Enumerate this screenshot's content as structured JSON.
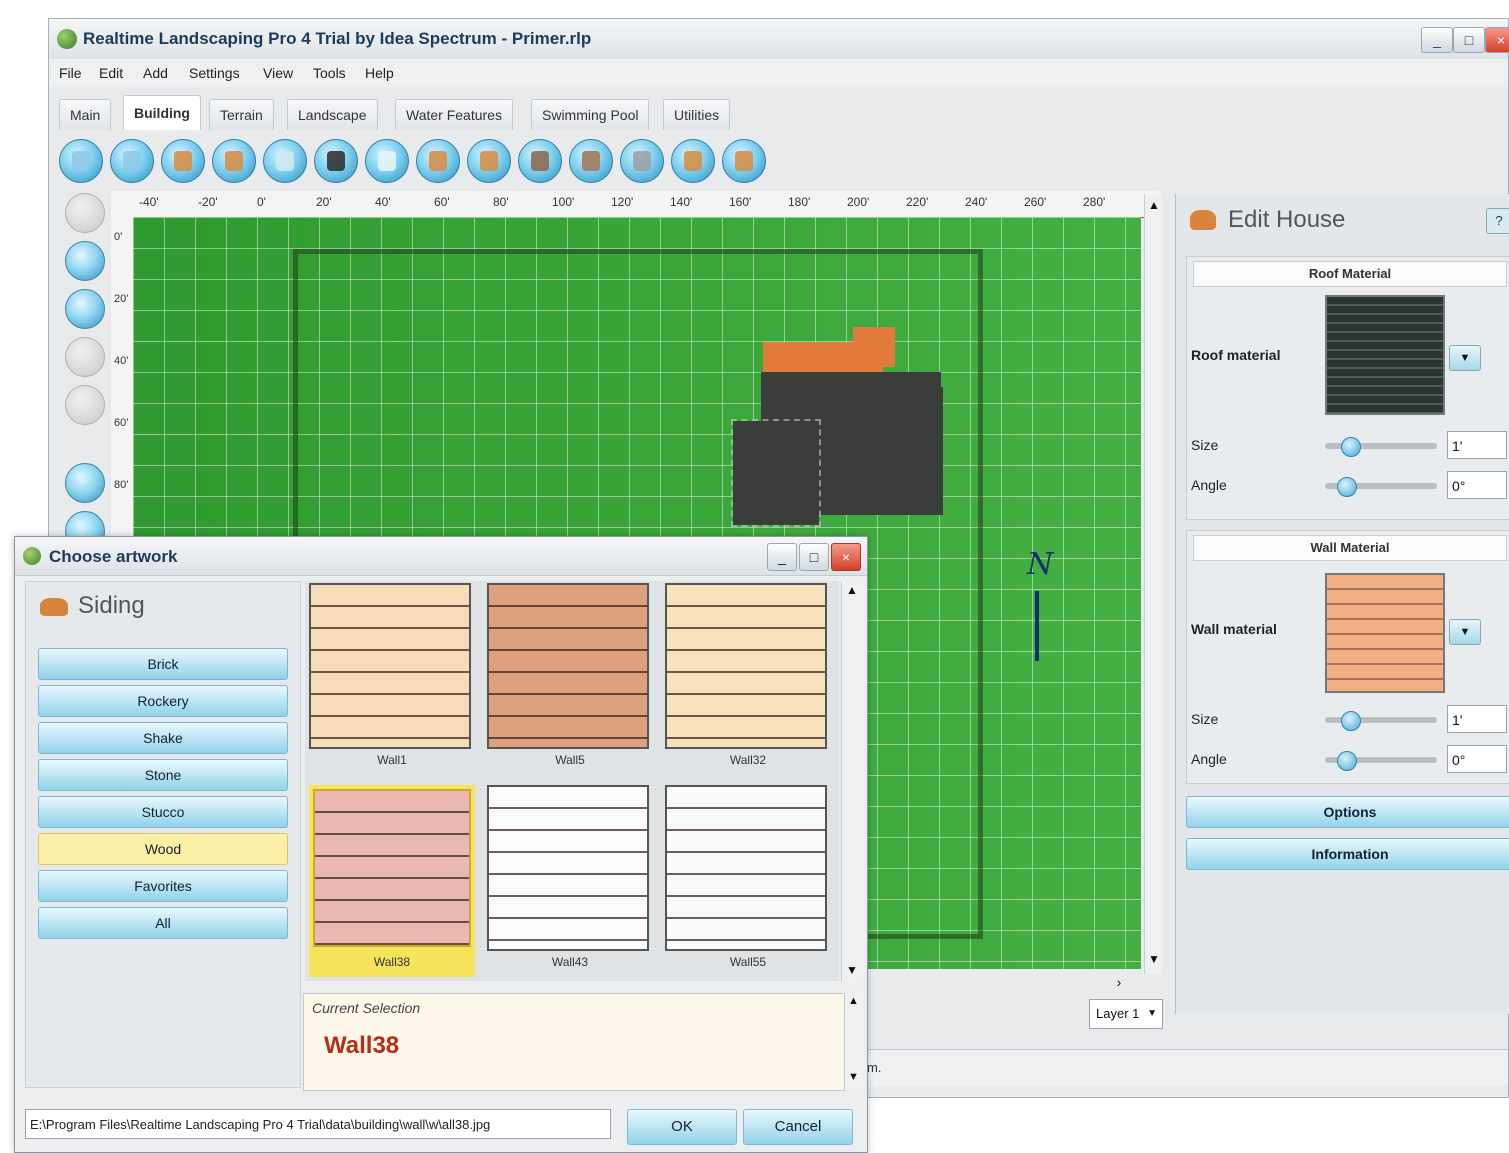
{
  "app": {
    "title": "Realtime Landscaping Pro 4 Trial by Idea Spectrum - Primer.rlp",
    "window_buttons": [
      "_",
      "□",
      "×"
    ]
  },
  "menu": [
    "File",
    "Edit",
    "Add",
    "Settings",
    "View",
    "Tools",
    "Help"
  ],
  "tabs": [
    "Main",
    "Building",
    "Terrain",
    "Landscape",
    "Water Features",
    "Swimming Pool",
    "Utilities"
  ],
  "active_tab": "Building",
  "ruler": {
    "top_labels": [
      "-40'",
      "-20'",
      "0'",
      "20'",
      "40'",
      "60'",
      "80'",
      "100'",
      "120'",
      "140'",
      "160'",
      "180'",
      "200'",
      "220'",
      "240'",
      "260'",
      "280'"
    ],
    "left_labels": [
      "0'",
      "20'",
      "40'",
      "60'",
      "80'"
    ]
  },
  "canvas": {
    "north_label": "N",
    "layer_select": "Layer 1",
    "status_text": "m."
  },
  "edit_panel": {
    "title": "Edit House",
    "help": "?",
    "roof_group": {
      "header": "Roof Material",
      "material_label": "Roof material",
      "size_label": "Size",
      "size_value": "1'",
      "angle_label": "Angle",
      "angle_value": "0°"
    },
    "wall_group": {
      "header": "Wall Material",
      "material_label": "Wall material",
      "size_label": "Size",
      "size_value": "1'",
      "angle_label": "Angle",
      "angle_value": "0°"
    },
    "options_button": "Options",
    "information_button": "Information"
  },
  "dialog": {
    "title": "Choose artwork",
    "category_title": "Siding",
    "categories": [
      "Brick",
      "Rockery",
      "Shake",
      "Stone",
      "Stucco",
      "Wood",
      "Favorites",
      "All"
    ],
    "selected_category": "Wood",
    "thumbnails": [
      {
        "label": "Wall1",
        "color": "#f6dcb8"
      },
      {
        "label": "Wall5",
        "color": "#dea17d"
      },
      {
        "label": "Wall32",
        "color": "#f8e2bc"
      },
      {
        "label": "Wall38",
        "color": "#eab7b2"
      },
      {
        "label": "Wall43",
        "color": "#fbfbfb"
      },
      {
        "label": "Wall55",
        "color": "#fafafa"
      }
    ],
    "selected_thumbnail": "Wall38",
    "current_selection_label": "Current Selection",
    "current_selection_value": "Wall38",
    "path": "E:\\Program Files\\Realtime Landscaping Pro 4 Trial\\data\\building\\wall\\w\\all38.jpg",
    "ok": "OK",
    "cancel": "Cancel"
  },
  "colors": {
    "lawn": "#3aa33a",
    "roof": "#3a3d3a",
    "roof_accent": "#e27a3a",
    "accent_button": "#90d2ea",
    "selection_highlight": "#f6e45c",
    "current_selection_text": "#b03018"
  }
}
